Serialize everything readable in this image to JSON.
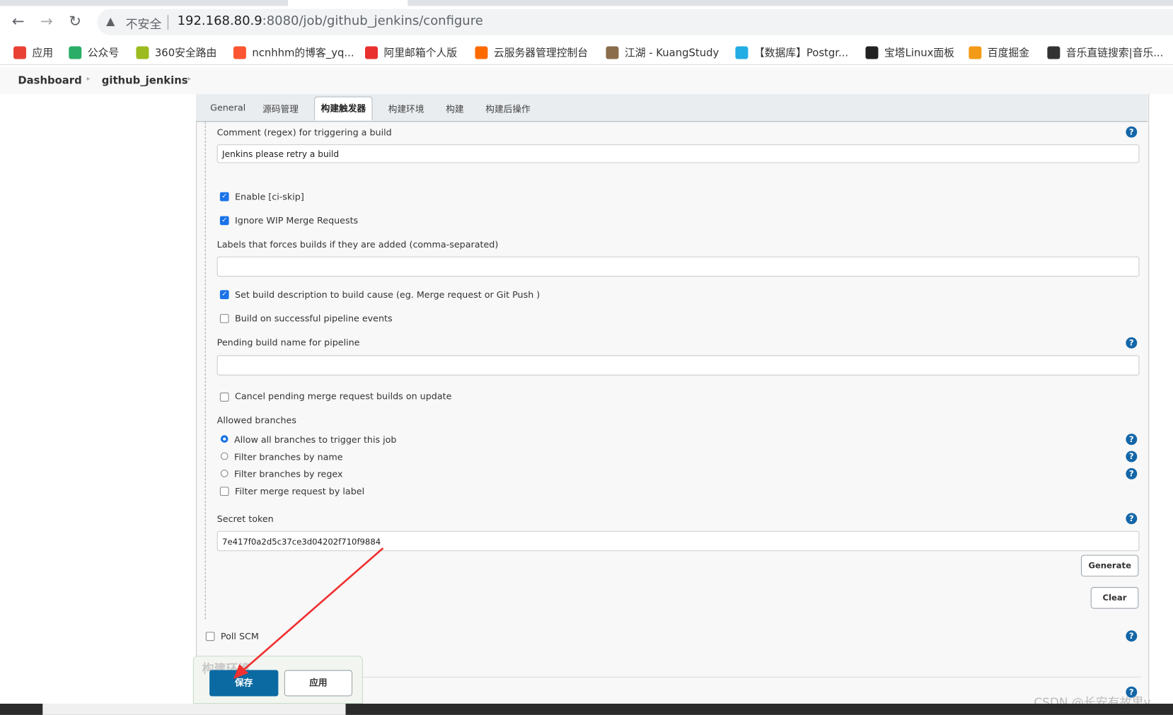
{
  "browser": {
    "insecure_label": "不安全",
    "url_host": "192.168.80.9",
    "url_rest": ":8080/job/github_jenkins/configure",
    "bookmarks": [
      {
        "label": "应用",
        "icon": "apps-grid-icon",
        "color": "#e94235"
      },
      {
        "label": "公众号",
        "icon": "wechat-public-icon",
        "color": "#2aae67"
      },
      {
        "label": "360安全路由",
        "icon": "360-router-icon",
        "color": "#9bbb1e"
      },
      {
        "label": "ncnhhm的博客_yq...",
        "icon": "csdn-icon",
        "color": "#fc5531"
      },
      {
        "label": "阿里邮箱个人版",
        "icon": "ali-mail-icon",
        "color": "#e9302e"
      },
      {
        "label": "云服务器管理控制台",
        "icon": "aliyun-icon",
        "color": "#ff6a00"
      },
      {
        "label": "江湖 - KuangStudy",
        "icon": "kuangstudy-avatar-icon",
        "color": "#8a6d4b"
      },
      {
        "label": "【数据库】Postgr...",
        "icon": "bilibili-icon",
        "color": "#23ade5"
      },
      {
        "label": "宝塔Linux面板",
        "icon": "bt-panel-icon",
        "color": "#222222"
      },
      {
        "label": "百度掘金",
        "icon": "juejin-icon",
        "color": "#f39a17"
      },
      {
        "label": "音乐直链搜索|音乐...",
        "icon": "liu-icon",
        "color": "#333333"
      }
    ]
  },
  "breadcrumb": {
    "items": [
      "Dashboard",
      "github_jenkins"
    ]
  },
  "tabs": [
    {
      "label": "General",
      "active": false
    },
    {
      "label": "源码管理",
      "active": false
    },
    {
      "label": "构建触发器",
      "active": true
    },
    {
      "label": "构建环境",
      "active": false
    },
    {
      "label": "构建",
      "active": false
    },
    {
      "label": "构建后操作",
      "active": false
    }
  ],
  "form": {
    "comment_label": "Comment (regex) for triggering a build",
    "comment_value": "Jenkins please retry a build",
    "enable_ci_skip": {
      "label": "Enable [ci-skip]",
      "checked": true
    },
    "ignore_wip": {
      "label": "Ignore WIP Merge Requests",
      "checked": true
    },
    "labels_label": "Labels that forces builds if they are added (comma-separated)",
    "labels_value": "",
    "set_desc": {
      "label": "Set build description to build cause (eg. Merge request or Git Push )",
      "checked": true
    },
    "build_on_success": {
      "label": "Build on successful pipeline events",
      "checked": false
    },
    "pending_label": "Pending build name for pipeline",
    "pending_value": "",
    "cancel_pending": {
      "label": "Cancel pending merge request builds on update",
      "checked": false
    },
    "allowed_branches_label": "Allowed branches",
    "branch_options": [
      {
        "label": "Allow all branches to trigger this job",
        "selected": true
      },
      {
        "label": "Filter branches by name",
        "selected": false
      },
      {
        "label": "Filter branches by regex",
        "selected": false
      }
    ],
    "filter_by_label": {
      "label": "Filter merge request by label",
      "checked": false
    },
    "secret_label": "Secret token",
    "secret_value": "7e417f0a2d5c37ce3d04202f710f9884",
    "generate_label": "Generate",
    "clear_label": "Clear",
    "poll_scm": {
      "label": "Poll SCM",
      "checked": false
    },
    "help_label": "?"
  },
  "footer": {
    "section_ghost": "构建环境",
    "save_label": "保存",
    "apply_label": "应用"
  },
  "watermark": "CSDN @长安有故里y",
  "colors": {
    "primary": "#0b6aa2",
    "help": "#1366a8",
    "checkbox": "#1a73e8",
    "annotation_arrow": "#f03030"
  }
}
